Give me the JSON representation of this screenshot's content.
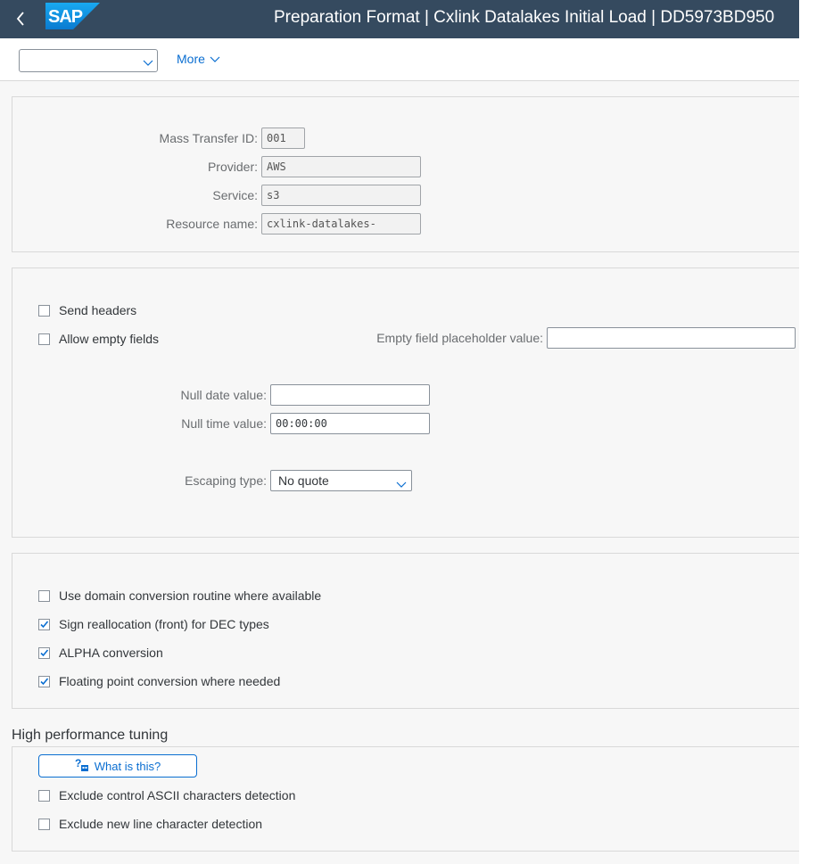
{
  "shell": {
    "back_icon": "chevron-left-icon",
    "logo": "SAP",
    "title": "Preparation Format | Cxlink Datalakes Initial Load | DD5973BD950"
  },
  "toolbar": {
    "select_value": "",
    "more_label": "More"
  },
  "header_panel": {
    "mass_transfer_id_label": "Mass Transfer ID:",
    "mass_transfer_id_value": "001",
    "provider_label": "Provider:",
    "provider_value": "AWS",
    "service_label": "Service:",
    "service_value": "s3",
    "resource_name_label": "Resource name:",
    "resource_name_value": "cxlink-datalakes-"
  },
  "format_panel": {
    "send_headers": {
      "label": "Send headers",
      "checked": false
    },
    "allow_empty_fields": {
      "label": "Allow empty fields",
      "checked": false
    },
    "empty_placeholder_label": "Empty field placeholder value:",
    "empty_placeholder_value": "",
    "null_date_label": "Null date value:",
    "null_date_value": "",
    "null_time_label": "Null time value:",
    "null_time_value": "00:00:00",
    "escaping_type_label": "Escaping type:",
    "escaping_type_value": "No quote"
  },
  "conversion_panel": {
    "items": [
      {
        "label": "Use domain conversion routine where available",
        "checked": false
      },
      {
        "label": "Sign reallocation (front) for DEC types",
        "checked": true
      },
      {
        "label": "ALPHA conversion",
        "checked": true
      },
      {
        "label": "Floating point conversion where needed",
        "checked": true
      }
    ]
  },
  "performance": {
    "title": "High performance tuning",
    "help_button_label": "What is this?",
    "help_icon": "help-icon",
    "items": [
      {
        "label": "Exclude control ASCII characters detection",
        "checked": false
      },
      {
        "label": "Exclude new line character detection",
        "checked": false
      }
    ]
  },
  "colors": {
    "shell_bg": "#354a5f",
    "accent": "#0a6ed1",
    "page_bg": "#f7f7f7"
  }
}
